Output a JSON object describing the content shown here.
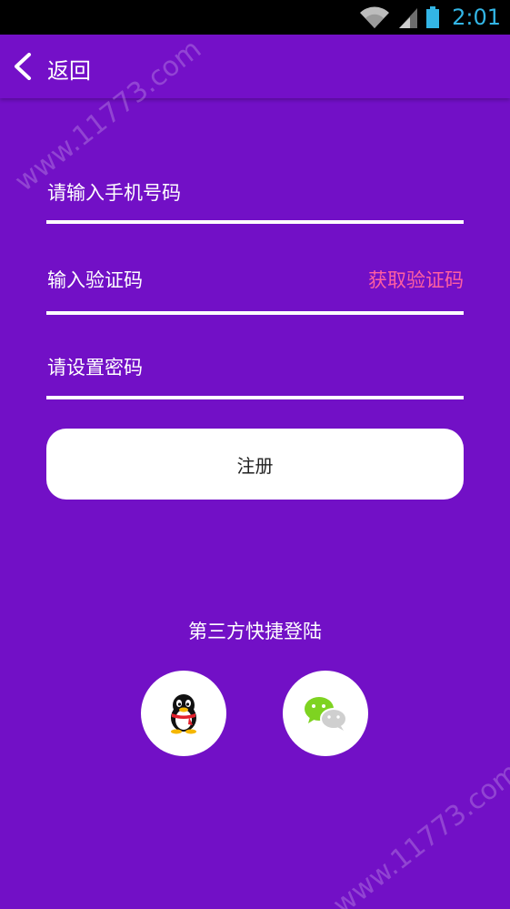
{
  "status_bar": {
    "time": "2:01"
  },
  "toolbar": {
    "back_label": "返回"
  },
  "form": {
    "phone_placeholder": "请输入手机号码",
    "code_placeholder": "输入验证码",
    "get_code_label": "获取验证码",
    "password_placeholder": "请设置密码",
    "register_label": "注册"
  },
  "social": {
    "title": "第三方快捷登陆",
    "qq_icon": "qq-penguin-icon",
    "wechat_icon": "wechat-icon"
  },
  "watermark": {
    "text": "www.11773.com"
  },
  "colors": {
    "background": "#7210c6",
    "accent_pink": "#ff5fa0",
    "status_blue": "#33b5e5"
  }
}
